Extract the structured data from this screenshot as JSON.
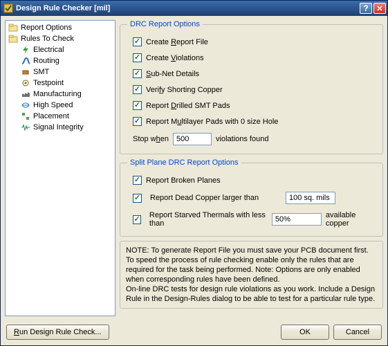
{
  "window": {
    "title": "Design Rule Checker [mil]"
  },
  "tree": {
    "report_options": "Report Options",
    "rules_to_check": "Rules To Check",
    "children": {
      "electrical": "Electrical",
      "routing": "Routing",
      "smt": "SMT",
      "testpoint": "Testpoint",
      "manufacturing": "Manufacturing",
      "high_speed": "High Speed",
      "placement": "Placement",
      "signal_integrity": "Signal Integrity"
    }
  },
  "group1": {
    "legend": "DRC Report Options",
    "create_report_file": "Create Report File",
    "create_violations": "Create Violations",
    "subnet_details": "Sub-Net Details",
    "verify_shorting_copper": "Verify Shorting Copper",
    "report_drilled_smt": "Report Drilled SMT Pads",
    "report_multilayer": "Report Multilayer Pads with 0 size Hole",
    "stop_when_prefix": "Stop when",
    "stop_when_value": "500",
    "stop_when_suffix": "violations found"
  },
  "group2": {
    "legend": "Split Plane DRC Report Options",
    "report_broken_planes": "Report Broken Planes",
    "report_dead_copper": "Report Dead Copper larger than",
    "dead_copper_value": "100 sq. mils",
    "report_starved_thermals": "Report Starved Thermals with less than",
    "starved_value": "50%",
    "available_copper": "available copper"
  },
  "note": {
    "line1": "NOTE: To generate Report File you must save your PCB document first.",
    "line2": "To speed the process of rule checking enable only the rules that are required for the task being performed.  Note: Options are only enabled when corresponding rules have been defined.",
    "line3": "On-line DRC tests for design rule violations as you work. Include a Design Rule in the Design-Rules dialog to be able to test for a particular rule  type."
  },
  "buttons": {
    "run": "Run Design Rule Check...",
    "ok": "OK",
    "cancel": "Cancel"
  }
}
